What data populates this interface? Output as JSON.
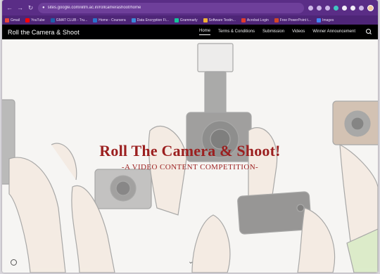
{
  "browser": {
    "url": "sites.google.com/iiitm.ac.in/rollcamerashoot/home",
    "bookmarks": [
      {
        "label": "Gmail",
        "color": "#e8453c"
      },
      {
        "label": "YouTube",
        "color": "#ff0000"
      },
      {
        "label": "GMAT CLUB - Tru...",
        "color": "#1f5fa8"
      },
      {
        "label": "Home - Coursera",
        "color": "#2a73cc"
      },
      {
        "label": "Data Encryption Fi...",
        "color": "#3b8ad9"
      },
      {
        "label": "Grammarly",
        "color": "#15c39a"
      },
      {
        "label": "Software Testin...",
        "color": "#f2b134"
      },
      {
        "label": "Acrobat Login",
        "color": "#e03b2e"
      },
      {
        "label": "Free PowerPoint t...",
        "color": "#d24726"
      },
      {
        "label": "Images",
        "color": "#4285f4"
      }
    ]
  },
  "site": {
    "title": "Roll the Camera & Shoot",
    "nav": [
      "Home",
      "Terms & Conditions",
      "Submission",
      "Videos",
      "Winner Announcement"
    ]
  },
  "hero": {
    "heading": "Roll The Camera & Shoot!",
    "subheading": "-A VIDEO CONTENT COMPETITION-"
  },
  "colors": {
    "accent": "#9b1f1f",
    "chrome": "#5a2d86"
  }
}
